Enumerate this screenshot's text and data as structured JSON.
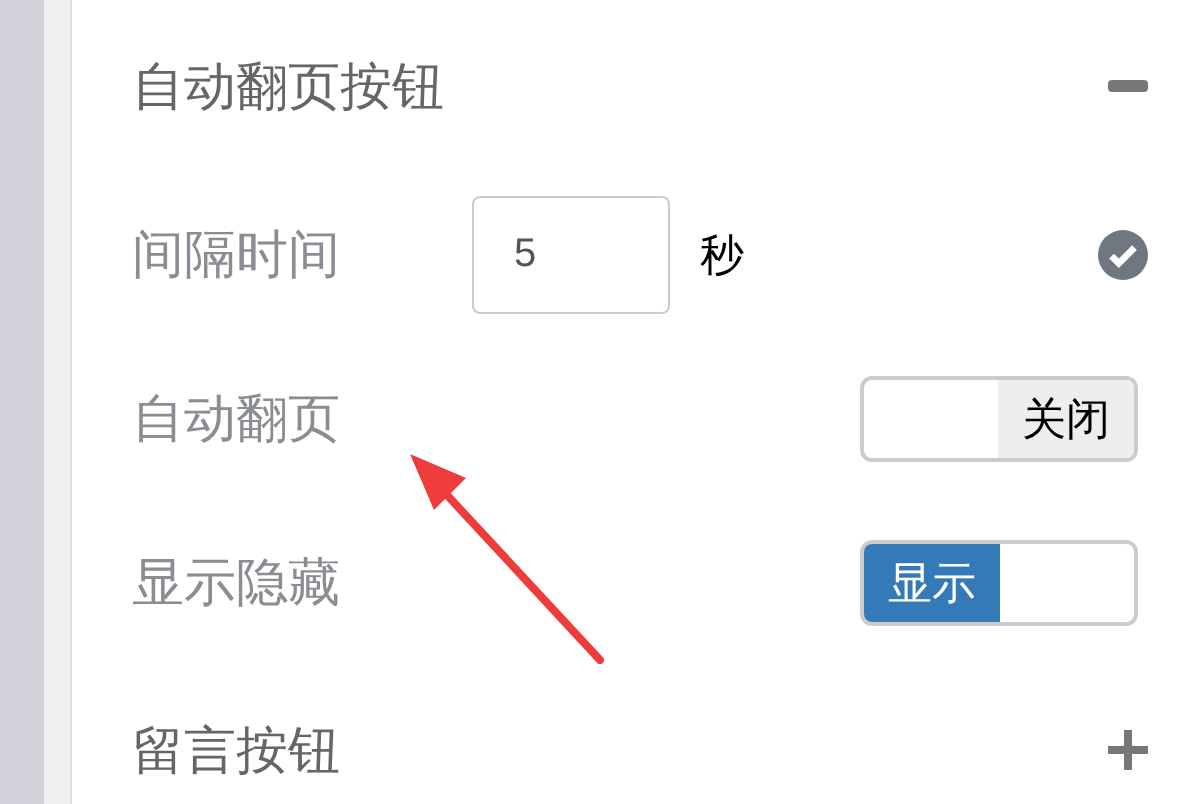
{
  "sections": [
    {
      "title": "自动翻页按钮",
      "expanded": true,
      "rows": [
        {
          "kind": "input",
          "label": "间隔时间",
          "value": "5",
          "unit": "秒",
          "valid": true
        },
        {
          "kind": "switch",
          "label": "自动翻页",
          "on": false,
          "state_text": "关闭"
        },
        {
          "kind": "switch",
          "label": "显示隐藏",
          "on": true,
          "state_text": "显示"
        }
      ]
    },
    {
      "title": "留言按钮",
      "expanded": false
    }
  ]
}
